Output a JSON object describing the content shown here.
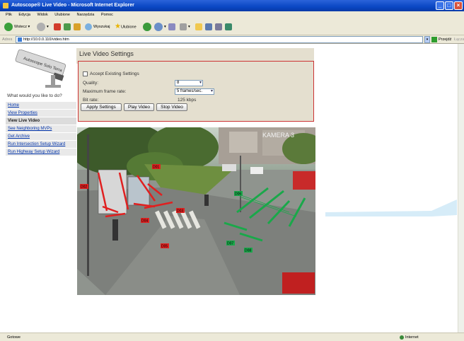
{
  "window": {
    "title": "Autoscope® Live Video - Microsoft Internet Explorer"
  },
  "menu": [
    "Plik",
    "Edycja",
    "Widok",
    "Ulubione",
    "Narzędzia",
    "Pomoc"
  ],
  "toolbar": {
    "back_label": "Wstecz",
    "search_label": "Wyszukaj",
    "favorites_label": "Ulubione"
  },
  "address": {
    "label": "Adres",
    "url": "http://10.0.0.110/video.htm",
    "go_label": "Przejdź",
    "links_label": "Łącza"
  },
  "sidebar": {
    "logo_text": "Autoscope Solo Terra",
    "prompt": "What would you like to do?",
    "items": [
      {
        "label": "Home",
        "active": false
      },
      {
        "label": "View Properties",
        "active": false
      },
      {
        "label": "View Live Video",
        "active": true
      },
      {
        "label": "See Neighboring MVPs",
        "active": false
      },
      {
        "label": "Get Archive",
        "active": false
      },
      {
        "label": "Run Intersection Setup Wizard",
        "active": false
      },
      {
        "label": "Run Highway Setup Wizard",
        "active": false
      }
    ]
  },
  "main": {
    "title": "Live Video Settings",
    "accept_label": "Accept Existing Settings",
    "quality_label": "Quality:",
    "quality_value": "8",
    "frame_rate_label": "Maximum frame rate:",
    "frame_rate_value": "5 frames/sec.",
    "bit_rate_label": "Bit rate:",
    "bit_rate_value": "125 kbps",
    "apply_label": "Apply Settings",
    "play_label": "Play Video",
    "stop_label": "Stop Video"
  },
  "video": {
    "overlay_text": "KAMERA 3",
    "detector_labels_red": [
      "D01",
      "D02",
      "D03",
      "D04",
      "D05"
    ],
    "detector_labels_green": [
      "D06",
      "D07",
      "D08"
    ]
  },
  "status": {
    "left": "Gotowe",
    "zone": "Internet"
  },
  "colors": {
    "titlebar": "#0a47c4",
    "detector_red": "#e02020",
    "detector_green": "#1aa84a",
    "link": "#0033aa"
  }
}
